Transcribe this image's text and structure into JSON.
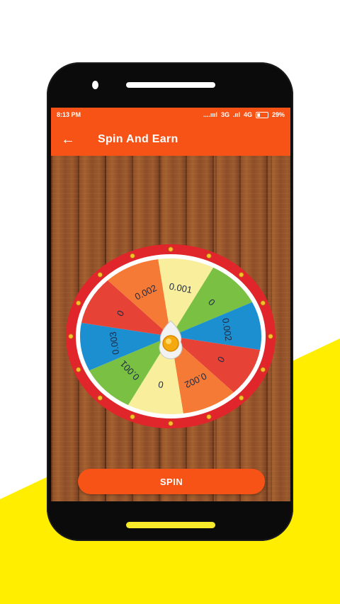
{
  "status": {
    "time": "8:13 PM",
    "signal1": "....ıııl",
    "net1": "3G",
    "signal2": ".ııl",
    "net2": "4G",
    "battery": "29%"
  },
  "appbar": {
    "title": "Spin And Earn"
  },
  "wheel": {
    "segments": [
      {
        "label": "0.001",
        "color": "#f8ee9c"
      },
      {
        "label": "0",
        "color": "#7ac143"
      },
      {
        "label": "0.002",
        "color": "#1c8fd1"
      },
      {
        "label": "0",
        "color": "#e64236"
      },
      {
        "label": "0.002",
        "color": "#f47a35"
      },
      {
        "label": "0",
        "color": "#f8ee9c"
      },
      {
        "label": "0.001",
        "color": "#7ac143"
      },
      {
        "label": "0.003",
        "color": "#1c8fd1"
      },
      {
        "label": "0",
        "color": "#e64236"
      },
      {
        "label": "0.002",
        "color": "#f47a35"
      }
    ],
    "rim_color": "#e0252b"
  },
  "spin_button": {
    "label": "SPIN"
  },
  "colors": {
    "accent": "#f85316",
    "background_stripe": "#ffee00"
  }
}
